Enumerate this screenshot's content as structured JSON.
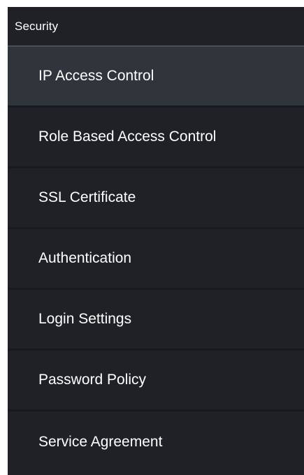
{
  "sidebar": {
    "section_title": "Security",
    "items": [
      {
        "label": "IP Access Control",
        "active": true
      },
      {
        "label": "Role Based Access Control",
        "active": false
      },
      {
        "label": "SSL Certificate",
        "active": false
      },
      {
        "label": "Authentication",
        "active": false
      },
      {
        "label": "Login Settings",
        "active": false
      },
      {
        "label": "Password Policy",
        "active": false
      },
      {
        "label": "Service Agreement",
        "active": false
      }
    ]
  },
  "colors": {
    "panel_background": "#1f2126",
    "active_item_background": "#30343b",
    "separator": "#171a1e",
    "header_rule": "#4a4f58",
    "text": "#ffffff"
  }
}
